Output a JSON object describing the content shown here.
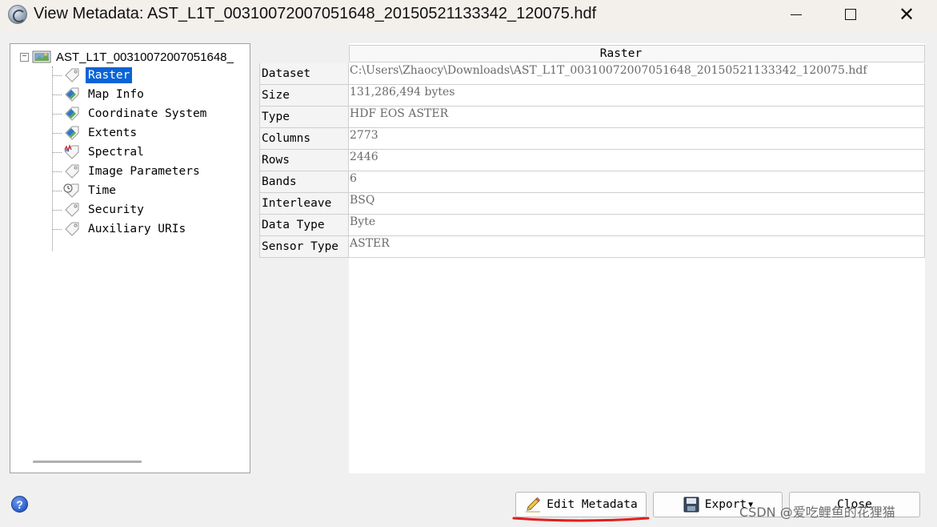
{
  "window": {
    "title": "View Metadata: AST_L1T_00310072007051648_20150521133342_120075.hdf",
    "minimize": "—",
    "maximize": "☐",
    "close": "✕"
  },
  "tree": {
    "root_label": "AST_L1T_00310072007051648_",
    "expander": "−",
    "items": [
      {
        "label": "Raster",
        "icon": "tag-icon",
        "selected": true
      },
      {
        "label": "Map Info",
        "icon": "map-tag-icon"
      },
      {
        "label": "Coordinate System",
        "icon": "map-tag-icon"
      },
      {
        "label": "Extents",
        "icon": "map-tag-icon"
      },
      {
        "label": "Spectral",
        "icon": "spectral-tag-icon"
      },
      {
        "label": "Image Parameters",
        "icon": "tag-icon"
      },
      {
        "label": "Time",
        "icon": "clock-tag-icon"
      },
      {
        "label": "Security",
        "icon": "tag-icon"
      },
      {
        "label": "Auxiliary URIs",
        "icon": "tag-icon"
      }
    ]
  },
  "grid": {
    "header": "Raster",
    "rows": [
      {
        "key": "Dataset",
        "value": "C:\\Users\\Zhaocy\\Downloads\\AST_L1T_00310072007051648_20150521133342_120075.hdf"
      },
      {
        "key": "Size",
        "value": "131,286,494 bytes"
      },
      {
        "key": "Type",
        "value": "HDF EOS ASTER"
      },
      {
        "key": "Columns",
        "value": "2773"
      },
      {
        "key": "Rows",
        "value": "2446"
      },
      {
        "key": "Bands",
        "value": "6"
      },
      {
        "key": "Interleave",
        "value": "BSQ"
      },
      {
        "key": "Data Type",
        "value": "Byte"
      },
      {
        "key": "Sensor Type",
        "value": "ASTER"
      }
    ]
  },
  "buttons": {
    "help": "?",
    "edit_metadata": "Edit Metadata",
    "export": "Export",
    "close": "Close"
  },
  "watermark": "CSDN @爱吃鲤鱼的花狸猫",
  "colors": {
    "selection": "#0a64d6",
    "annotation_underline": "#e0201c"
  }
}
